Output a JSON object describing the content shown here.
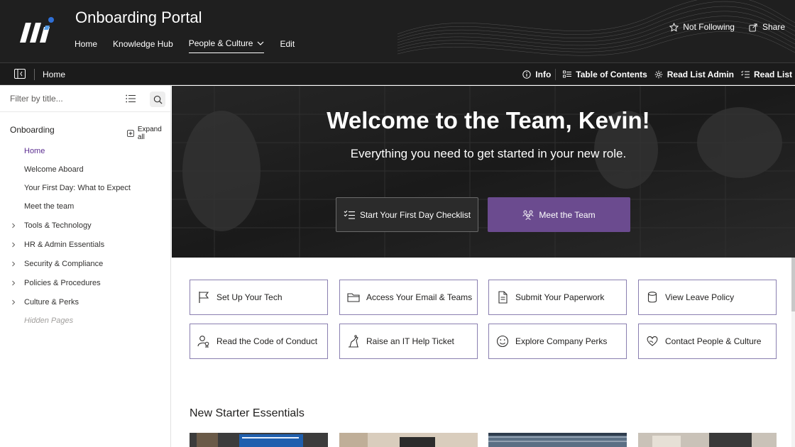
{
  "header": {
    "site_title": "Onboarding Portal",
    "nav": [
      {
        "label": "Home"
      },
      {
        "label": "Knowledge Hub"
      },
      {
        "label": "People & Culture"
      },
      {
        "label": "Edit"
      }
    ],
    "follow_label": "Not Following",
    "share_label": "Share",
    "logo_icon": "site-logo"
  },
  "command_bar": {
    "breadcrumb": "Home",
    "info_label": "Info",
    "toc_label": "Table of Contents",
    "read_list_admin_label": "Read List Admin",
    "read_list_label": "Read List"
  },
  "sidebar": {
    "filter_placeholder": "Filter by title...",
    "section_title": "Onboarding",
    "expand_all_label": "Expand all",
    "items": [
      {
        "label": "Home",
        "active": true,
        "expandable": false
      },
      {
        "label": "Welcome Aboard",
        "expandable": false
      },
      {
        "label": "Your First Day: What to Expect",
        "expandable": false
      },
      {
        "label": "Meet the team",
        "expandable": false
      },
      {
        "label": "Tools & Technology",
        "expandable": true
      },
      {
        "label": "HR & Admin Essentials",
        "expandable": true
      },
      {
        "label": "Security & Compliance",
        "expandable": true
      },
      {
        "label": "Policies & Procedures",
        "expandable": true
      },
      {
        "label": "Culture & Perks",
        "expandable": true
      },
      {
        "label": "Hidden Pages",
        "expandable": false
      }
    ]
  },
  "hero": {
    "title": "Welcome to the Team, Kevin!",
    "subtitle": "Everything you need to get started in your new role.",
    "btn_checklist": "Start Your First Day Checklist",
    "btn_team": "Meet the Team"
  },
  "quick_links": [
    {
      "label": "Set Up Your Tech",
      "icon": "flag-icon"
    },
    {
      "label": "Access Your Email & Teams",
      "icon": "folder-icon"
    },
    {
      "label": "Submit Your Paperwork",
      "icon": "document-icon"
    },
    {
      "label": "View Leave Policy",
      "icon": "database-icon"
    },
    {
      "label": "Read the Code of Conduct",
      "icon": "person-badge-icon"
    },
    {
      "label": "Raise an IT Help Ticket",
      "icon": "help-ticket-icon"
    },
    {
      "label": "Explore Company Perks",
      "icon": "smiley-icon"
    },
    {
      "label": "Contact People & Culture",
      "icon": "heart-hands-icon"
    }
  ],
  "essentials": {
    "title": "New Starter Essentials"
  },
  "colors": {
    "header_bg": "#1f1f1f",
    "accent_purple": "#6b4b8f",
    "active_nav": "#5c2e91",
    "link_border": "#8a7fb0"
  }
}
